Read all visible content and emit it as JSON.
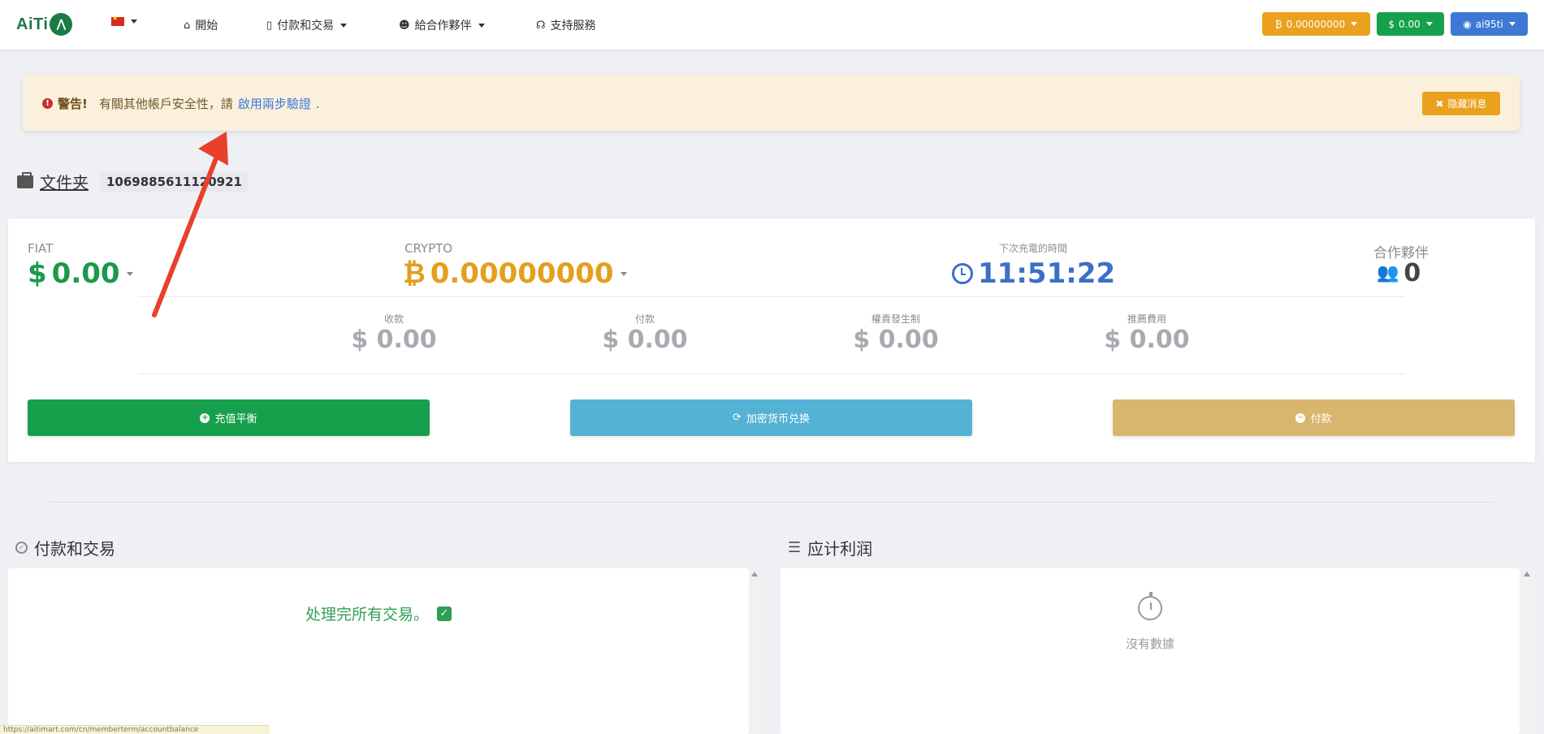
{
  "nav": {
    "logo_text": "AiTi",
    "home_label": "開始",
    "payments_label": "付款和交易",
    "partners_label": "給合作夥伴",
    "support_label": "支持服務",
    "btc_balance": "0.00000000",
    "usd_balance": "0.00",
    "username": "ai95ti"
  },
  "alert": {
    "title": "警告!",
    "text": "有關其他帳戶安全性，請",
    "link": "啟用兩步驗證",
    "suffix": ".",
    "hide_label": "隐藏消息"
  },
  "folder": {
    "label": "文件夹",
    "id": "1069885611120921"
  },
  "balances": {
    "fiat_caption": "FIAT",
    "fiat_value": "0.00",
    "crypto_caption": "CRYPTO",
    "crypto_value": "0.00000000",
    "timer_caption": "下次充電的時間",
    "timer_value": "11:51:22",
    "partners_caption": "合作夥伴",
    "partners_value": "0",
    "stats": [
      {
        "label": "收款",
        "value": "$ 0.00"
      },
      {
        "label": "付款",
        "value": "$ 0.00"
      },
      {
        "label": "權責發生制",
        "value": "$ 0.00"
      },
      {
        "label": "推薦費用",
        "value": "$ 0.00"
      }
    ]
  },
  "actions": {
    "topup": "充值平衡",
    "exchange": "加密货币兑换",
    "pay": "付款"
  },
  "sections": {
    "transactions_title": "付款和交易",
    "transactions_done": "处理完所有交易。",
    "profit_title": "应计利润",
    "no_data": "沒有數據"
  },
  "statusbar": {
    "url": "https://aitimart.com/cn/memberterm/accountbalance"
  },
  "colors": {
    "green": "#17a04c",
    "orange": "#e9a11e",
    "blue": "#3d79d4",
    "cyan": "#54b2d4",
    "tan": "#d9b66e",
    "arrow": "#e8402a"
  }
}
